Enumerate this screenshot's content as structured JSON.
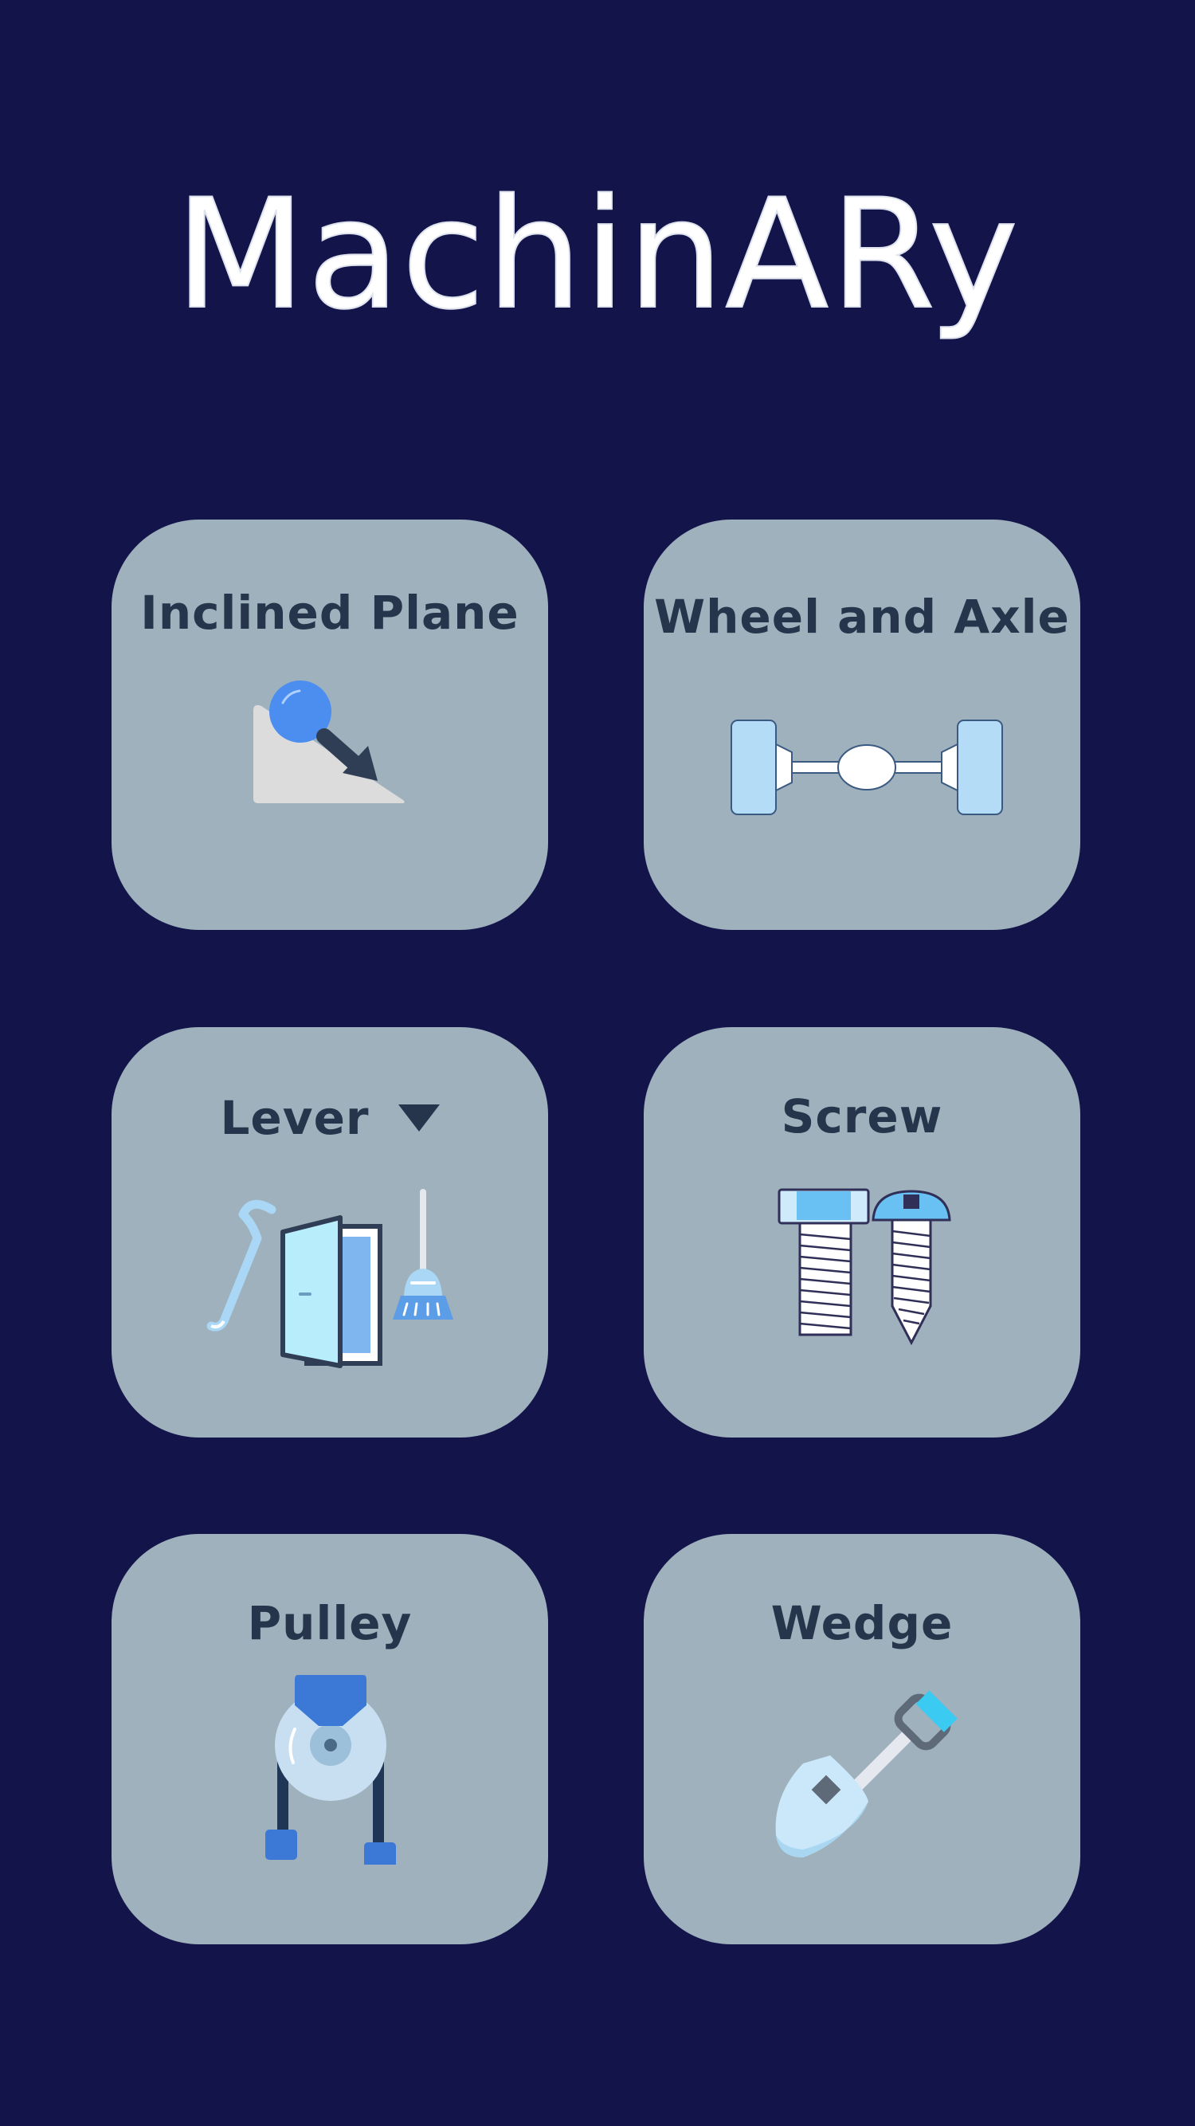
{
  "app": {
    "title": "MachinARy"
  },
  "cards": [
    {
      "label": "Inclined Plane",
      "icon": "inclined-plane-icon"
    },
    {
      "label": "Wheel and Axle",
      "icon": "wheel-and-axle-icon"
    },
    {
      "label": "Lever",
      "icon": "lever-icon",
      "has_dropdown": true
    },
    {
      "label": "Screw",
      "icon": "screw-icon"
    },
    {
      "label": "Pulley",
      "icon": "pulley-icon"
    },
    {
      "label": "Wedge",
      "icon": "wedge-icon"
    }
  ],
  "colors": {
    "background": "#131449",
    "card": "#9eb1bd",
    "title_text": "#26354b",
    "logo": "#ffffff"
  }
}
